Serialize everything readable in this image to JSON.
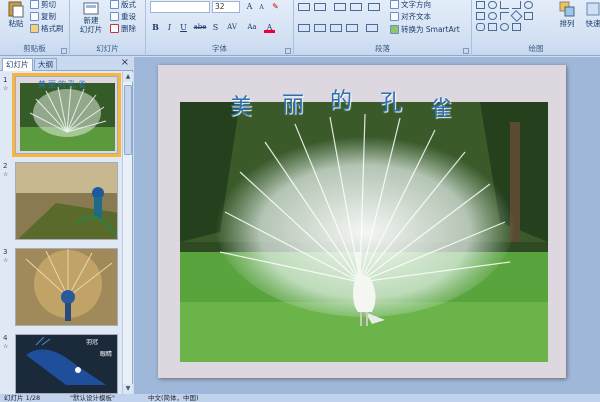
{
  "ribbon": {
    "clipboard": {
      "paste": "粘贴",
      "cut": "剪切",
      "copy": "复制",
      "format_painter": "格式刷",
      "label": "剪贴板"
    },
    "slides": {
      "new_slide": "新建\n幻灯片",
      "layout": "版式",
      "reset": "重设",
      "delete": "删除",
      "label": "幻灯片"
    },
    "font": {
      "font_name": "",
      "font_size": "32",
      "label": "字体",
      "bold": "B",
      "italic": "I",
      "underline": "U",
      "strike": "abe",
      "shadow": "S",
      "spacing": "AV",
      "case": "Aa",
      "color": "A",
      "grow": "A",
      "shrink": "A"
    },
    "paragraph": {
      "text_direction": "文字方向",
      "align_text": "对齐文本",
      "smartart": "转换为 SmartArt",
      "label": "段落"
    },
    "drawing": {
      "arrange": "排列",
      "quick_styles": "快速",
      "label": "绘图"
    }
  },
  "panel": {
    "tab_slides": "幻灯片",
    "tab_outline": "大纲",
    "close": "×",
    "thumbs": [
      {
        "num": "1",
        "anim": "☆",
        "caption": "美丽的孔雀"
      },
      {
        "num": "2",
        "anim": "☆",
        "caption": ""
      },
      {
        "num": "3",
        "anim": "☆",
        "caption": ""
      },
      {
        "num": "4",
        "anim": "☆",
        "caption": ""
      }
    ],
    "thumb4_labels": [
      "羽冠",
      "眼睛"
    ]
  },
  "slide": {
    "title_chars": [
      "美",
      "丽",
      "的",
      "孔",
      "雀"
    ]
  },
  "status": {
    "slide_count": "幻灯片 1/28",
    "theme": "\"默认设计模板\"",
    "language": "中文(简体，中国)"
  },
  "colors": {
    "accent": "#f6b73c",
    "title": "#2a6fae",
    "ribbon": "#d3e1f3"
  }
}
